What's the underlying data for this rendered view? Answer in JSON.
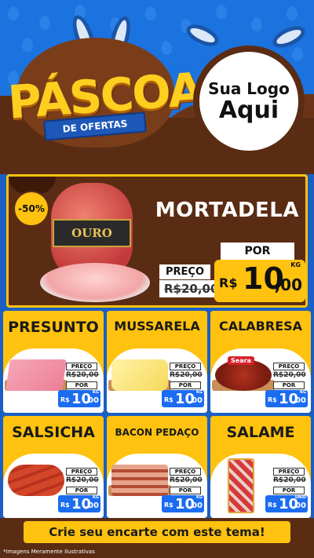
{
  "header": {
    "title": "PÁSCOA",
    "ribbon": "DE OFERTAS",
    "logo_line1": "Sua Logo",
    "logo_line2": "Aqui"
  },
  "featured": {
    "discount": "-50%",
    "brand": "OURO",
    "name": "MORTADELA",
    "preco_label": "PREÇO",
    "old_price": "R$20,00",
    "por_label": "POR",
    "currency": "R$",
    "price_int": "10",
    "price_dec": ",00",
    "unit": "KG"
  },
  "products": [
    {
      "name": "PRESUNTO",
      "preco_label": "PREÇO",
      "old_price": "R$20,00",
      "por_label": "POR",
      "currency": "R$",
      "price_int": "10",
      "price_dec": ",00",
      "unit": "KG"
    },
    {
      "name": "MUSSARELA",
      "preco_label": "PREÇO",
      "old_price": "R$20,00",
      "por_label": "POR",
      "currency": "R$",
      "price_int": "10",
      "price_dec": ",00",
      "unit": "KG"
    },
    {
      "name": "CALABRESA",
      "brand": "Seara",
      "preco_label": "PREÇO",
      "old_price": "R$20,00",
      "por_label": "POR",
      "currency": "R$",
      "price_int": "10",
      "price_dec": ",00",
      "unit": "KG"
    },
    {
      "name": "SALSICHA",
      "preco_label": "PREÇO",
      "old_price": "R$20,00",
      "por_label": "POR",
      "currency": "R$",
      "price_int": "10",
      "price_dec": ",00",
      "unit": "KG"
    },
    {
      "name": "BACON PEDAÇO",
      "preco_label": "PREÇO",
      "old_price": "R$20,00",
      "por_label": "POR",
      "currency": "R$",
      "price_int": "10",
      "price_dec": ",00",
      "unit": "KG"
    },
    {
      "name": "SALAME",
      "preco_label": "PREÇO",
      "old_price": "R$20,00",
      "por_label": "POR",
      "currency": "R$",
      "price_int": "10",
      "price_dec": ",00",
      "unit": "UNID"
    }
  ],
  "footer": {
    "note": "*Imagens Meramente Ilustrativas",
    "cta": "Crie seu encarte com este tema!"
  },
  "colors": {
    "blue_bg": "#1a73de",
    "chocolate": "#5a2c14",
    "yellow": "#ffc20e",
    "price_blue": "#1b6cf0"
  }
}
